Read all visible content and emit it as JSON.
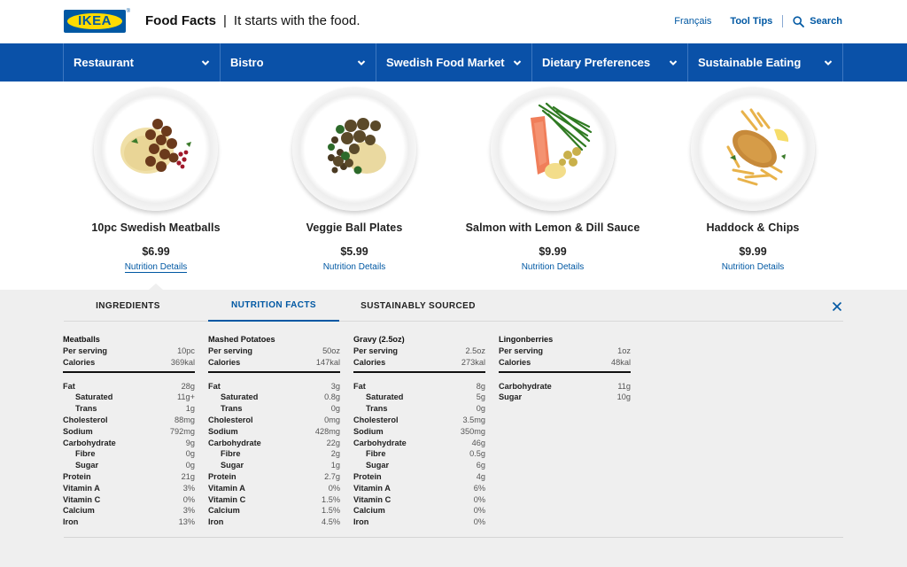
{
  "header": {
    "logo_text": "IKEA",
    "logo_mark": "®",
    "title": "Food Facts",
    "separator": "|",
    "tagline": "It starts with the food.",
    "language_link": "Français",
    "tooltips_link": "Tool Tips",
    "search_label": "Search",
    "search_icon": "search-icon"
  },
  "nav": {
    "items": [
      {
        "label": "Restaurant"
      },
      {
        "label": "Bistro"
      },
      {
        "label": "Swedish Food Market"
      },
      {
        "label": "Dietary Preferences"
      },
      {
        "label": "Sustainable Eating"
      }
    ],
    "chevron_icon": "chevron-down-icon"
  },
  "products": [
    {
      "name": "10pc Swedish Meatballs",
      "price": "$6.99",
      "link": "Nutrition Details"
    },
    {
      "name": "Veggie Ball Plates",
      "price": "$5.99",
      "link": "Nutrition Details"
    },
    {
      "name": "Salmon with Lemon & Dill Sauce",
      "price": "$9.99",
      "link": "Nutrition Details"
    },
    {
      "name": "Haddock & Chips",
      "price": "$9.99",
      "link": "Nutrition Details"
    }
  ],
  "panel": {
    "tabs": [
      {
        "label": "INGREDIENTS"
      },
      {
        "label": "NUTRITION FACTS"
      },
      {
        "label": "SUSTAINABLY SOURCED"
      }
    ],
    "close_icon": "close-icon",
    "columns": [
      {
        "title": "Meatballs",
        "top": [
          [
            "Per serving",
            "10pc"
          ],
          [
            "Calories",
            "369kal"
          ]
        ],
        "rows": [
          [
            "Fat",
            "28g",
            false
          ],
          [
            "Saturated",
            "11g+",
            true
          ],
          [
            "Trans",
            "1g",
            true
          ],
          [
            "Cholesterol",
            "88mg",
            false
          ],
          [
            "Sodium",
            "792mg",
            false
          ],
          [
            "Carbohydrate",
            "9g",
            false
          ],
          [
            "Fibre",
            "0g",
            true
          ],
          [
            "Sugar",
            "0g",
            true
          ],
          [
            "Protein",
            "21g",
            false
          ],
          [
            "Vitamin A",
            "3%",
            false
          ],
          [
            "Vitamin C",
            "0%",
            false
          ],
          [
            "Calcium",
            "3%",
            false
          ],
          [
            "Iron",
            "13%",
            false
          ]
        ]
      },
      {
        "title": "Mashed Potatoes",
        "top": [
          [
            "Per serving",
            "50oz"
          ],
          [
            "Calories",
            "147kal"
          ]
        ],
        "rows": [
          [
            "Fat",
            "3g",
            false
          ],
          [
            "Saturated",
            "0.8g",
            true
          ],
          [
            "Trans",
            "0g",
            true
          ],
          [
            "Cholesterol",
            "0mg",
            false
          ],
          [
            "Sodium",
            "428mg",
            false
          ],
          [
            "Carbohydrate",
            "22g",
            false
          ],
          [
            "Fibre",
            "2g",
            true
          ],
          [
            "Sugar",
            "1g",
            true
          ],
          [
            "Protein",
            "2.7g",
            false
          ],
          [
            "Vitamin A",
            "0%",
            false
          ],
          [
            "Vitamin C",
            "1.5%",
            false
          ],
          [
            "Calcium",
            "1.5%",
            false
          ],
          [
            "Iron",
            "4.5%",
            false
          ]
        ]
      },
      {
        "title": "Gravy (2.5oz)",
        "top": [
          [
            "Per serving",
            "2.5oz"
          ],
          [
            "Calories",
            "273kal"
          ]
        ],
        "rows": [
          [
            "Fat",
            "8g",
            false
          ],
          [
            "Saturated",
            "5g",
            true
          ],
          [
            "Trans",
            "0g",
            true
          ],
          [
            "Cholesterol",
            "3.5mg",
            false
          ],
          [
            "Sodium",
            "350mg",
            false
          ],
          [
            "Carbohydrate",
            "46g",
            false
          ],
          [
            "Fibre",
            "0.5g",
            true
          ],
          [
            "Sugar",
            "6g",
            true
          ],
          [
            "Protein",
            "4g",
            false
          ],
          [
            "Vitamin A",
            "6%",
            false
          ],
          [
            "Vitamin C",
            "0%",
            false
          ],
          [
            "Calcium",
            "0%",
            false
          ],
          [
            "Iron",
            "0%",
            false
          ]
        ]
      },
      {
        "title": "Lingonberries",
        "top": [
          [
            "Per serving",
            "1oz"
          ],
          [
            "Calories",
            "48kal"
          ]
        ],
        "rows": [
          [
            "Carbohydrate",
            "11g",
            false
          ],
          [
            "Sugar",
            "10g",
            false
          ]
        ]
      }
    ]
  },
  "colors": {
    "brand_blue": "#0058a3",
    "nav_blue": "#0a51a8",
    "brand_yellow": "#ffdb00",
    "panel_bg": "#efefef"
  }
}
